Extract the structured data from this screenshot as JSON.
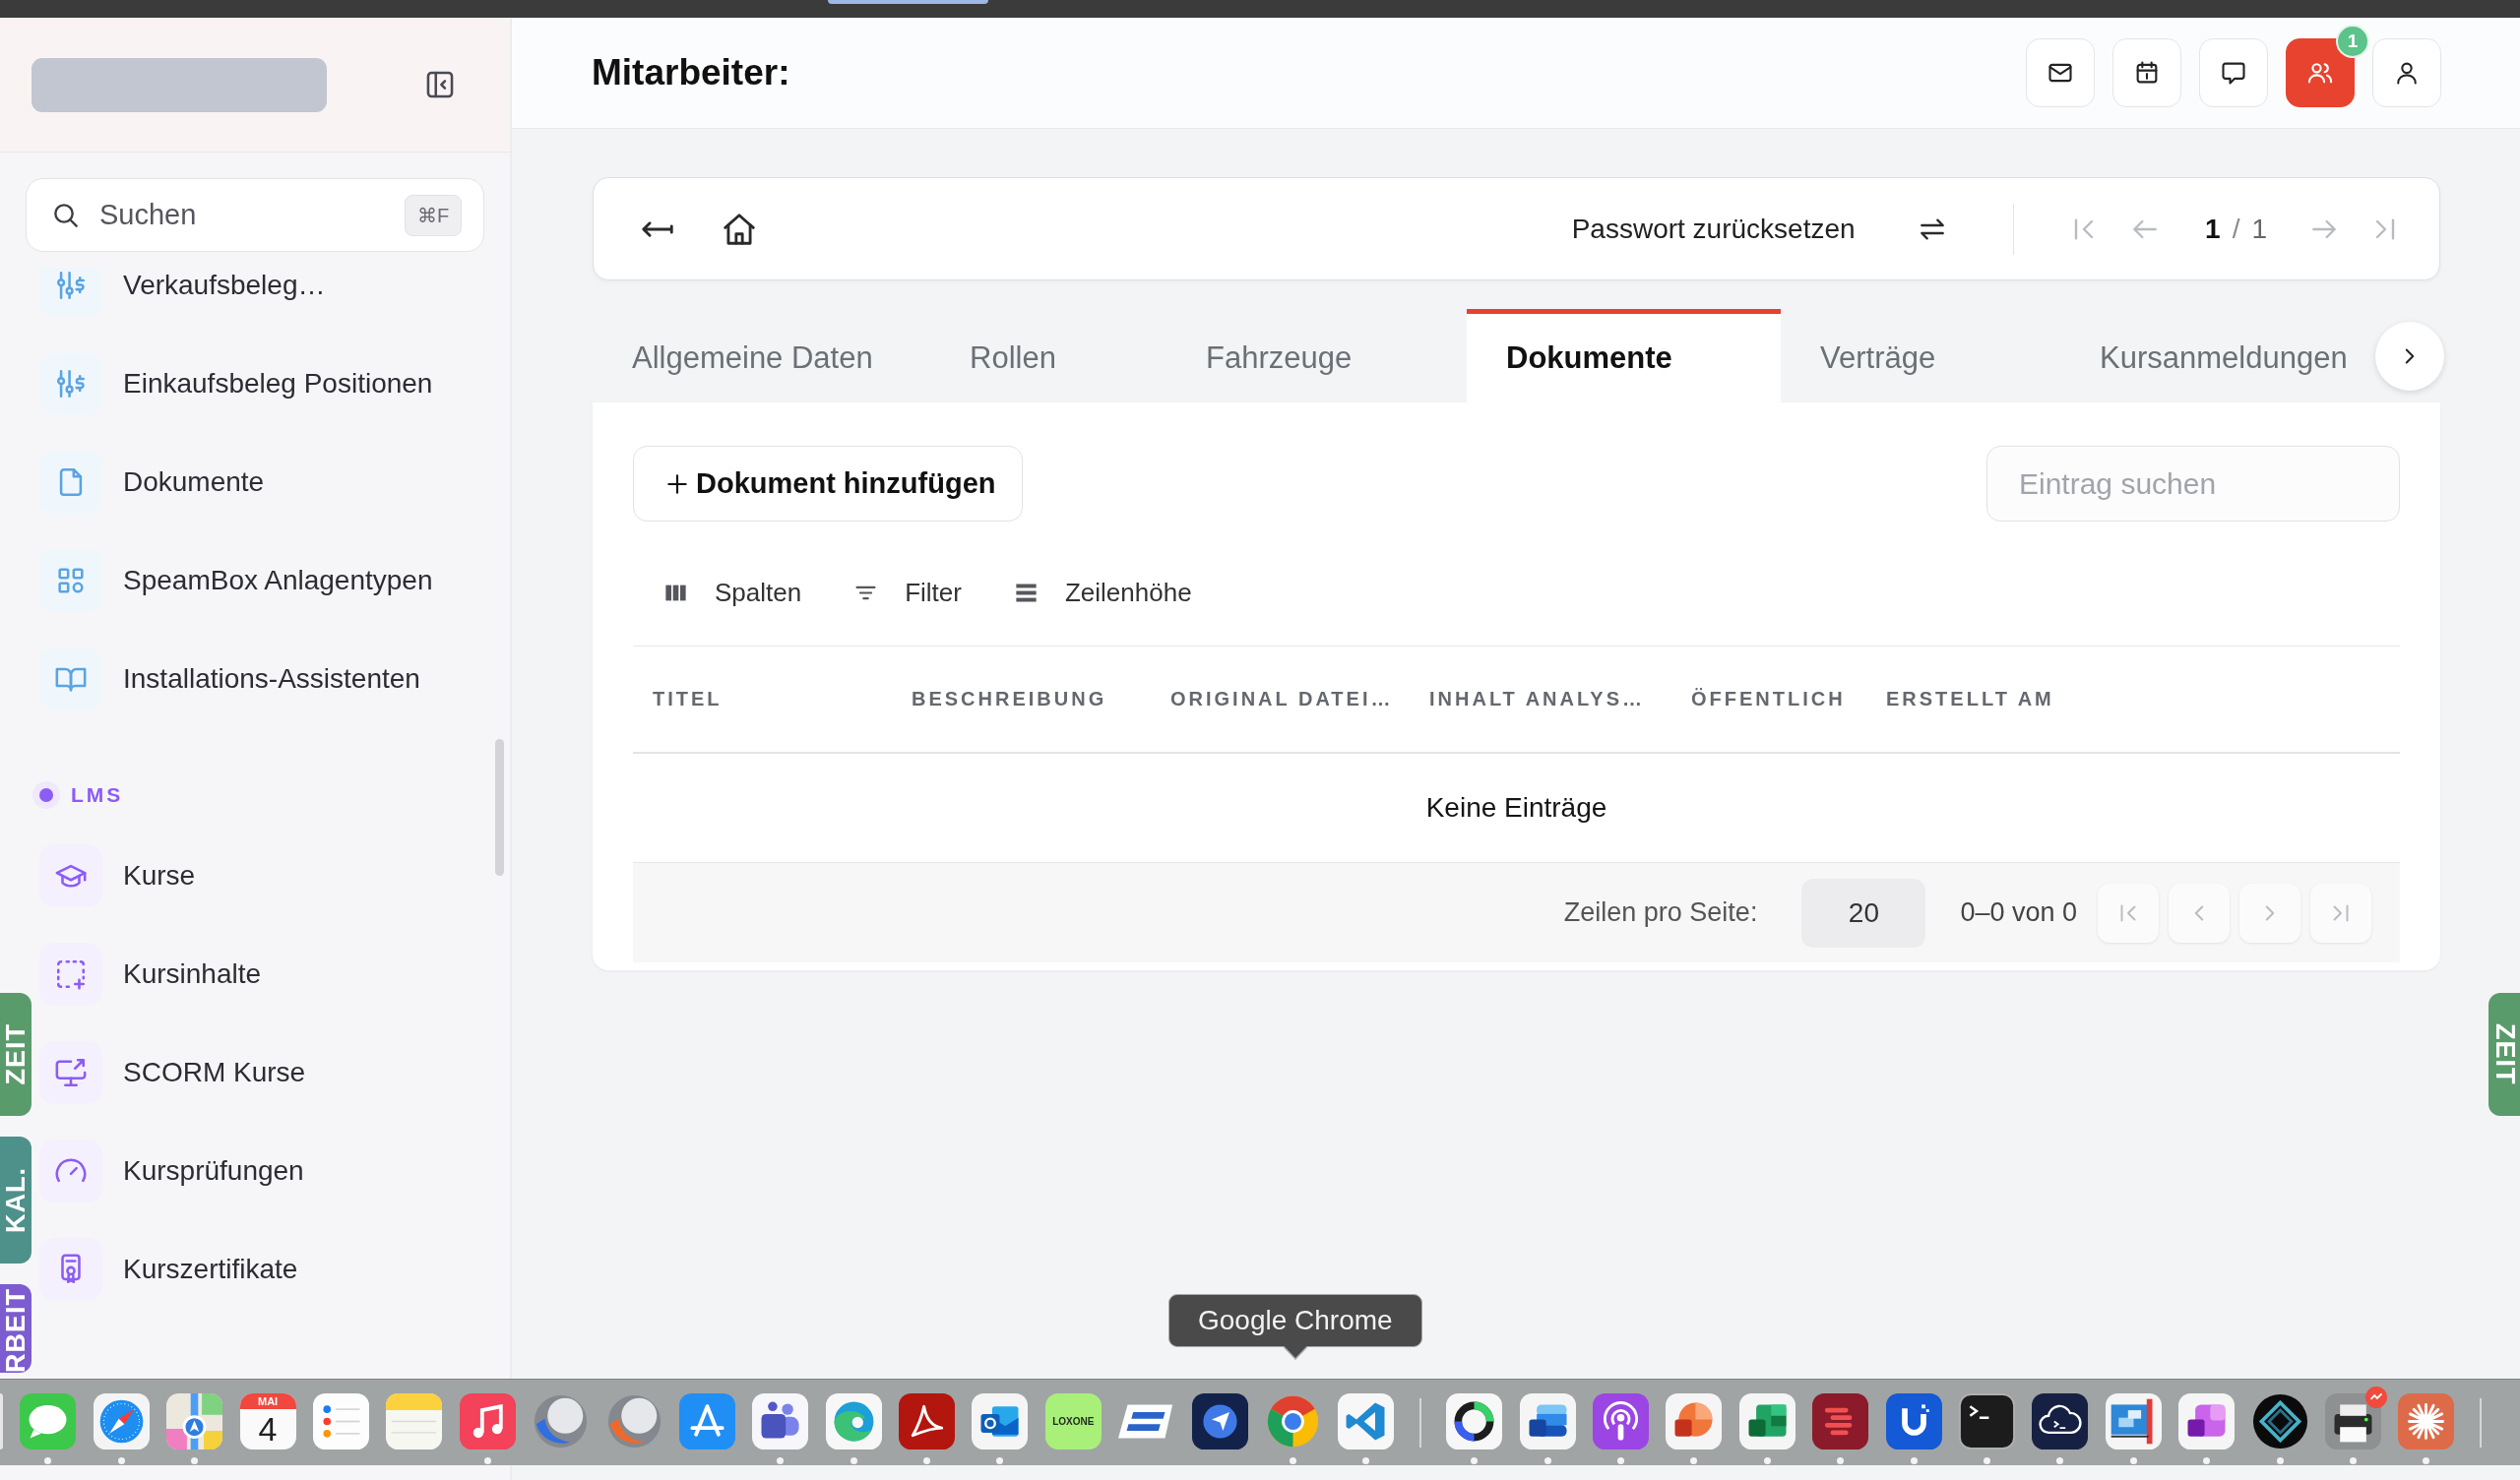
{
  "sidebar": {
    "search": {
      "placeholder": "Suchen",
      "shortcut": "⌘F"
    },
    "sections": [
      {
        "color": "#5aa4e2",
        "items": [
          {
            "label": "Verkaufsbeleg…"
          },
          {
            "label": "Einkaufsbeleg Positionen"
          },
          {
            "label": "Dokumente"
          },
          {
            "label": "SpeamBox Anlagentypen"
          },
          {
            "label": "Installations-Assistenten"
          }
        ]
      },
      {
        "title": "LMS",
        "color": "#8b5cf6",
        "items": [
          {
            "label": "Kurse"
          },
          {
            "label": "Kursinhalte"
          },
          {
            "label": "SCORM Kurse"
          },
          {
            "label": "Kursprüfungen"
          },
          {
            "label": "Kurszertifikate"
          }
        ]
      }
    ]
  },
  "header": {
    "title": "Mitarbeiter:",
    "actions": [
      {
        "active": false
      },
      {
        "active": false
      },
      {
        "active": false
      },
      {
        "active": true,
        "badge": "1"
      },
      {
        "active": false
      }
    ]
  },
  "record_toolbar": {
    "action": "Passwort zurücksetzen",
    "page_current": "1",
    "page_separator": "/",
    "page_total": "1",
    "nav": [
      {
        "disabled": true
      },
      {
        "disabled": true
      },
      {
        "disabled": true
      },
      {
        "disabled": true
      }
    ]
  },
  "tabs": [
    {
      "label": "Allgemeine Daten",
      "selected": false
    },
    {
      "label": "Rollen",
      "selected": false
    },
    {
      "label": "Fahrzeuge",
      "selected": false
    },
    {
      "label": "Dokumente",
      "selected": true
    },
    {
      "label": "Verträge",
      "selected": false
    },
    {
      "label": "Kursanmeldungen",
      "selected": false
    }
  ],
  "documents": {
    "add_button": "Dokument hinzufügen",
    "search": {
      "placeholder": "Eintrag suchen"
    },
    "tools": [
      "Spalten",
      "Filter",
      "Zeilenhöhe"
    ],
    "table": {
      "columns": [
        "TITEL",
        "BESCHREIBUNG",
        "ORIGINAL DATEI…",
        "INHALT ANALYS…",
        "ÖFFENTLICH",
        "ERSTELLT AM"
      ],
      "empty_message": "Keine Einträge"
    },
    "footer": {
      "rows_per_page_label": "Zeilen pro Seite:",
      "rows_per_page": "20",
      "range": "0–0 von 0",
      "nav": [
        {
          "disabled": true
        },
        {
          "disabled": true
        },
        {
          "disabled": true
        },
        {
          "disabled": true
        }
      ]
    }
  },
  "edge_tabs": {
    "left": [
      {
        "label": "ZEIT",
        "color": "#5a9b6b"
      },
      {
        "label": "KAL.",
        "color": "#4e918a"
      },
      {
        "label": "RBEIT",
        "color": "#7c5ccf"
      }
    ],
    "right": [
      {
        "label": "ZEIT",
        "color": "#5a9b6b"
      }
    ]
  },
  "dock": {
    "groups": [
      {
        "apps": [
          {
            "running": false
          },
          {
            "running": true
          },
          {
            "running": true
          },
          {
            "running": true
          },
          {
            "running": false,
            "month": "MAI",
            "day": "4"
          },
          {
            "running": false
          },
          {
            "running": false
          },
          {
            "running": true
          },
          {
            "running": false
          },
          {
            "running": false
          },
          {
            "running": false
          },
          {
            "running": true
          },
          {
            "running": true
          },
          {
            "running": true
          },
          {
            "running": true
          },
          {
            "running": false,
            "label": "LOXONE"
          },
          {
            "running": false
          },
          {
            "running": false
          },
          {
            "running": true
          },
          {
            "running": true
          }
        ]
      },
      {
        "apps": [
          {
            "running": true
          },
          {
            "running": true
          },
          {
            "running": true
          },
          {
            "running": true
          },
          {
            "running": true
          },
          {
            "running": true
          },
          {
            "running": true
          },
          {
            "running": true
          },
          {
            "running": true
          },
          {
            "running": true
          },
          {
            "running": true
          },
          {
            "running": true
          },
          {
            "running": true
          },
          {
            "running": true
          }
        ]
      }
    ],
    "tooltip": "Google Chrome"
  }
}
